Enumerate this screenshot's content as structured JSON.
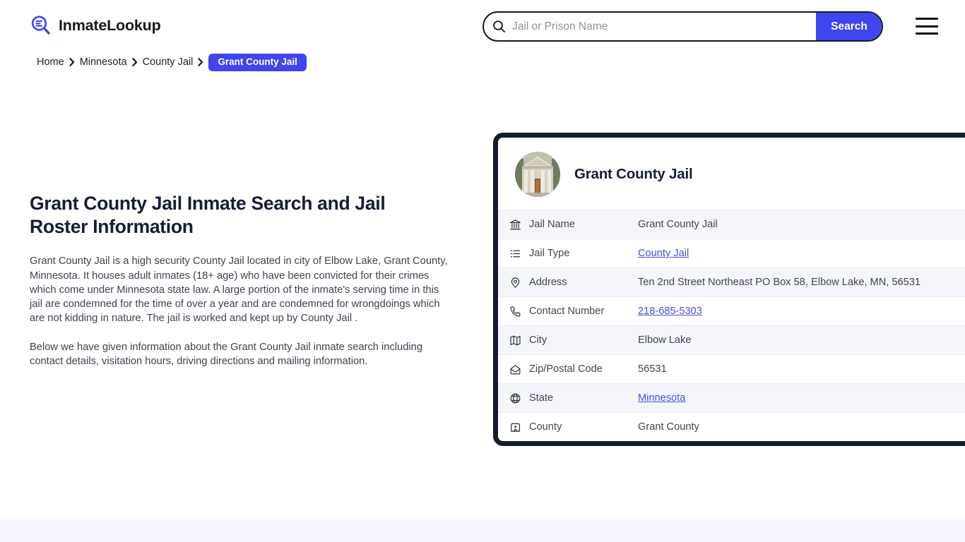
{
  "header": {
    "brand_name": "InmateLookup",
    "brand_icon": "magnifier-list-icon",
    "search": {
      "placeholder": "Jail or Prison Name",
      "value": "",
      "button_label": "Search",
      "icon": "search-icon"
    },
    "menu_icon": "hamburger-menu-icon",
    "accent_color": "#3f45ef"
  },
  "breadcrumb": {
    "items": [
      {
        "label": "Home",
        "current": false
      },
      {
        "label": "Minnesota",
        "current": false
      },
      {
        "label": "County Jail",
        "current": false
      },
      {
        "label": "Grant County Jail",
        "current": true
      }
    ]
  },
  "article": {
    "title": "Grant County Jail Inmate Search and Jail Roster Information",
    "paragraphs": [
      "Grant County Jail is a high security County Jail located in city of Elbow Lake, Grant County, Minnesota. It houses adult inmates (18+ age) who have been convicted for their crimes which come under Minnesota state law. A large portion of the inmate's serving time in this jail are condemned for the time of over a year and are condemned for wrongdoings which are not kidding in nature. The jail is worked and kept up by County Jail .",
      "Below we have given information about the Grant County Jail inmate search including contact details, visitation hours, driving directions and mailing information."
    ]
  },
  "card": {
    "title": "Grant County Jail",
    "avatar_icon": "courthouse-photo",
    "border_color": "#151c32",
    "rows": [
      {
        "icon": "bank-icon",
        "label": "Jail Name",
        "value": "Grant County Jail",
        "link": false
      },
      {
        "icon": "list-icon",
        "label": "Jail Type",
        "value": "County Jail",
        "link": true
      },
      {
        "icon": "map-pin-icon",
        "label": "Address",
        "value": "Ten 2nd Street Northeast PO Box 58, Elbow Lake, MN, 56531",
        "link": false
      },
      {
        "icon": "phone-icon",
        "label": "Contact Number",
        "value": "218-685-5303",
        "link": true
      },
      {
        "icon": "map-icon",
        "label": "City",
        "value": "Elbow Lake",
        "link": false
      },
      {
        "icon": "envelope-icon",
        "label": "Zip/Postal Code",
        "value": "56531",
        "link": false
      },
      {
        "icon": "globe-icon",
        "label": "State",
        "value": "Minnesota",
        "link": true
      },
      {
        "icon": "county-icon",
        "label": "County",
        "value": "Grant County",
        "link": false
      }
    ]
  }
}
